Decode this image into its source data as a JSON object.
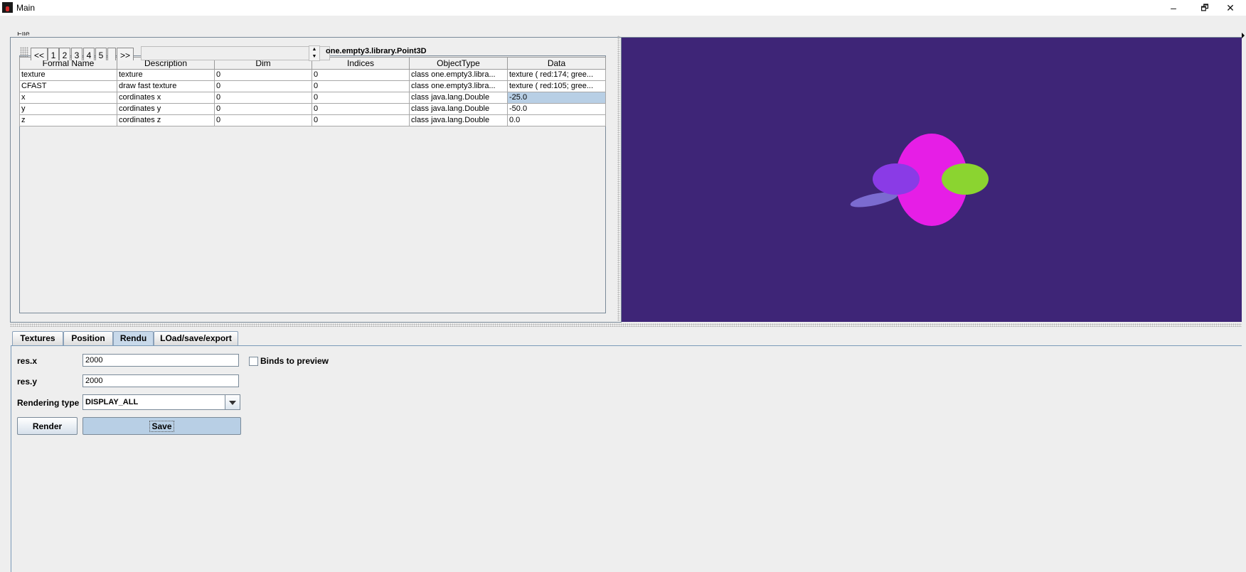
{
  "window": {
    "title": "Main",
    "minimize": "–",
    "maximize": "🗗",
    "close": "✕"
  },
  "menu": {
    "file": "File"
  },
  "pager": {
    "prev": "<<",
    "pages": [
      "1",
      "2",
      "3",
      "4",
      "5"
    ],
    "next": ">>"
  },
  "object_class": "one.empty3.library.Point3D",
  "table": {
    "columns": [
      "Formal Name",
      "Description",
      "Dim",
      "Indices",
      "ObjectType",
      "Data"
    ],
    "rows": [
      [
        "texture",
        "texture",
        "0",
        "0",
        "class one.empty3.libra...",
        "texture ( red:174; gree..."
      ],
      [
        "CFAST",
        "draw fast texture",
        "0",
        "0",
        "class one.empty3.libra...",
        "texture ( red:105; gree..."
      ],
      [
        "x",
        "cordinates x",
        "0",
        "0",
        "class java.lang.Double",
        "-25.0"
      ],
      [
        "y",
        "cordinates y",
        "0",
        "0",
        "class java.lang.Double",
        "-50.0"
      ],
      [
        "z",
        "cordinates z",
        "0",
        "0",
        "class java.lang.Double",
        "0.0"
      ]
    ],
    "selected_row": 2,
    "selected_col": 5
  },
  "preview": {
    "background": "#3e2577",
    "shapes": [
      {
        "name": "shadow-ellipse",
        "color": "#7b6bd0"
      },
      {
        "name": "body-ellipse",
        "color": "#e61ee6"
      },
      {
        "name": "left-ellipse",
        "color": "#8a3be6"
      },
      {
        "name": "right-ellipse",
        "color": "#8bd430"
      }
    ]
  },
  "tabs": [
    "Textures",
    "Position",
    "Rendu",
    "LOad/save/export"
  ],
  "active_tab": "Rendu",
  "form": {
    "res_x_label": "res.x",
    "res_x_value": "2000",
    "res_y_label": "res.y",
    "res_y_value": "2000",
    "rendering_type_label": "Rendering type",
    "rendering_type_value": "DISPLAY_ALL",
    "binds_label": "Binds to preview",
    "binds_checked": false,
    "render_button": "Render",
    "save_button": "Save"
  }
}
